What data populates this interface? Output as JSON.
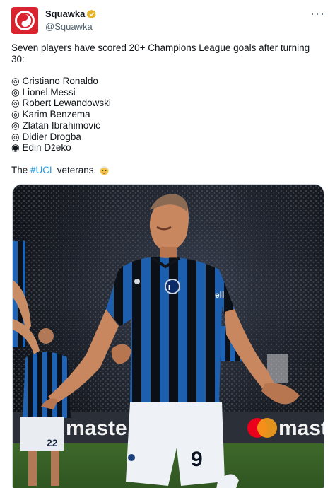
{
  "author": {
    "display_name": "Squawka",
    "handle": "@Squawka",
    "verified_color": "#e6b325",
    "avatar_color": "#d9232e"
  },
  "menu": {
    "more_label": "···"
  },
  "tweet": {
    "intro_line1": "Seven players have scored 20+ Champions League goals after turning",
    "intro_line2": "30:",
    "players": [
      {
        "bullet": "◎",
        "name": "Cristiano Ronaldo"
      },
      {
        "bullet": "◎",
        "name": "Lionel Messi"
      },
      {
        "bullet": "◎",
        "name": "Robert Lewandowski"
      },
      {
        "bullet": "◎",
        "name": "Karim Benzema"
      },
      {
        "bullet": "◎",
        "name": "Zlatan Ibrahimović"
      },
      {
        "bullet": "◎",
        "name": "Didier Drogba"
      },
      {
        "bullet": "◉",
        "name": "Edin Džeko"
      }
    ],
    "closing_prefix": "The ",
    "hashtag": "#UCL",
    "closing_suffix": " veterans.",
    "emoji": "older-man-emoji"
  },
  "media": {
    "description_icon": "photo-image",
    "board_text_left": "maste",
    "board_text_right": "maste",
    "shirt_number": "9",
    "sponsor_text": "ell"
  }
}
